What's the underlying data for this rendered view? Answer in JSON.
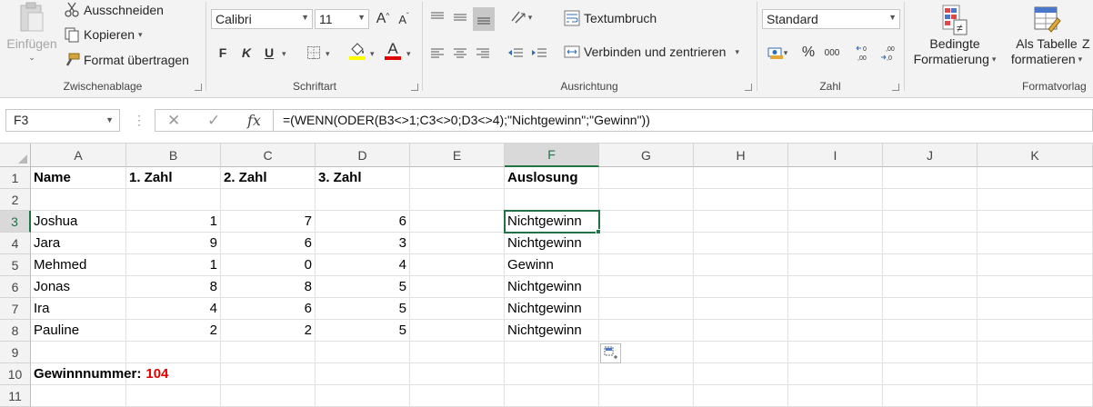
{
  "ribbon": {
    "clipboard": {
      "paste_label": "Einfügen",
      "cut_label": "Ausschneiden",
      "copy_label": "Kopieren",
      "format_painter_label": "Format übertragen",
      "group_label": "Zwischenablage"
    },
    "font": {
      "font_name": "Calibri",
      "font_size": "11",
      "bold_label": "F",
      "italic_label": "K",
      "underline_label": "U",
      "grow_label": "A",
      "shrink_label": "A",
      "font_color_label": "A",
      "group_label": "Schriftart"
    },
    "alignment": {
      "wrap_text_label": "Textumbruch",
      "merge_center_label": "Verbinden und zentrieren",
      "group_label": "Ausrichtung"
    },
    "number": {
      "format_value": "Standard",
      "percent_label": "%",
      "thousands_label": "000",
      "group_label": "Zahl"
    },
    "styles": {
      "conditional_formatting_line1": "Bedingte",
      "conditional_formatting_line2": "Formatierung",
      "format_as_table_line1": "Als Tabelle",
      "format_as_table_line2": "formatieren",
      "group_label": "Formatvorlag"
    }
  },
  "formula_bar": {
    "name_box": "F3",
    "fx_label": "fx",
    "formula": "=(WENN(ODER(B3<>1;C3<>0;D3<>4);\"Nichtgewinn\";\"Gewinn\"))"
  },
  "grid": {
    "columns": [
      "A",
      "B",
      "C",
      "D",
      "E",
      "F",
      "G",
      "H",
      "I",
      "J",
      "K"
    ],
    "rows": [
      "1",
      "2",
      "3",
      "4",
      "5",
      "6",
      "7",
      "8",
      "9",
      "10",
      "11"
    ],
    "header": {
      "name": "Name",
      "z1": "1. Zahl",
      "z2": "2. Zahl",
      "z3": "3. Zahl",
      "result": "Auslosung"
    },
    "data": [
      {
        "name": "Joshua",
        "z1": "1",
        "z2": "7",
        "z3": "6",
        "result": "Nichtgewinn"
      },
      {
        "name": "Jara",
        "z1": "9",
        "z2": "6",
        "z3": "3",
        "result": "Nichtgewinn"
      },
      {
        "name": "Mehmed",
        "z1": "1",
        "z2": "0",
        "z3": "4",
        "result": "Gewinn"
      },
      {
        "name": "Jonas",
        "z1": "8",
        "z2": "8",
        "z3": "5",
        "result": "Nichtgewinn"
      },
      {
        "name": "Ira",
        "z1": "4",
        "z2": "6",
        "z3": "5",
        "result": "Nichtgewinn"
      },
      {
        "name": "Pauline",
        "z1": "2",
        "z2": "2",
        "z3": "5",
        "result": "Nichtgewinn"
      }
    ],
    "winning_label": "Gewinnnummer:",
    "winning_number": "104"
  },
  "colors": {
    "accent": "#217346",
    "red": "#e00000"
  }
}
